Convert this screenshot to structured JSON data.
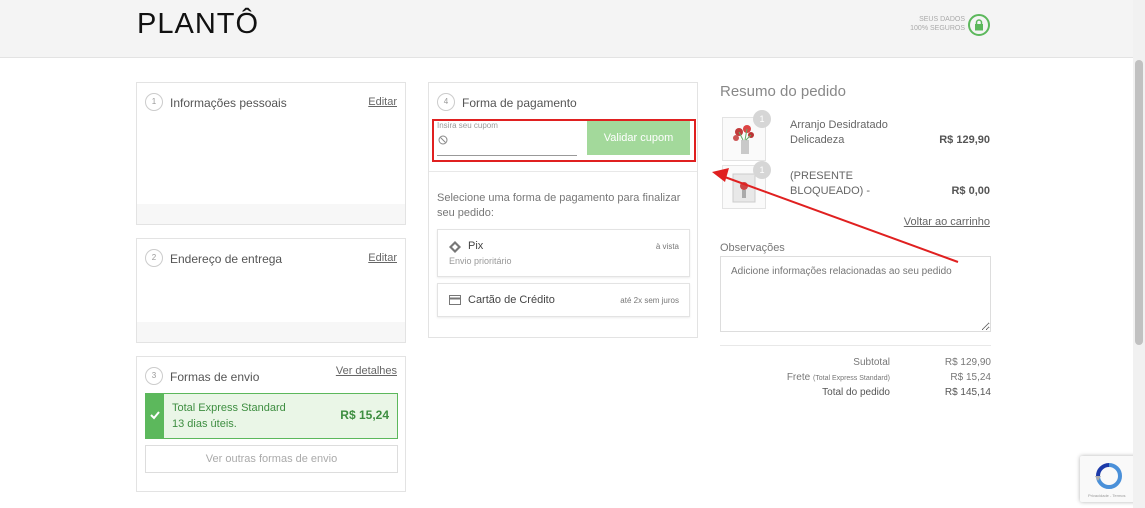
{
  "header": {
    "logo": "PLANTÔ",
    "secure_line1": "SEUS DADOS",
    "secure_line2": "100% SEGUROS",
    "lock_icon": "lock-icon"
  },
  "personal": {
    "step": "1",
    "title": "Informações pessoais",
    "edit_label": "Editar"
  },
  "delivery": {
    "step": "2",
    "title": "Endereço de entrega",
    "edit_label": "Editar"
  },
  "shipping": {
    "step": "3",
    "title": "Formas de envio",
    "details_label": "Ver detalhes",
    "selected_name": "Total Express Standard",
    "selected_days": "13 dias úteis.",
    "selected_price": "R$ 15,24",
    "other_options_label": "Ver outras formas de envio"
  },
  "payment": {
    "step": "4",
    "title": "Forma de pagamento",
    "coupon_label": "Insira seu cupom",
    "coupon_value": "",
    "coupon_button": "Validar cupom",
    "instructions": "Selecione uma forma de pagamento para finalizar seu pedido:",
    "options": [
      {
        "name": "Pix",
        "sub": "Envio prioritário",
        "right": "à vista",
        "icon": "pix-icon"
      },
      {
        "name": "Cartão de Crédito",
        "sub": "",
        "right": "até 2x sem juros",
        "icon": "credit-card-icon"
      }
    ]
  },
  "summary": {
    "title": "Resumo do pedido",
    "products": [
      {
        "qty": "1",
        "name": "Arranjo Desidratado Delicadeza",
        "price": "R$ 129,90"
      },
      {
        "qty": "1",
        "name": "(PRESENTE BLOQUEADO) -",
        "price": "R$ 0,00"
      }
    ],
    "cart_link": "Voltar ao carrinho",
    "obs_label": "Observações",
    "obs_placeholder": "Adicione informações relacionadas ao seu pedido",
    "subtotal_label": "Subtotal",
    "subtotal_value": "R$ 129,90",
    "shipping_label": "Frete",
    "shipping_sub": "(Total Express Standard)",
    "shipping_value": "R$ 15,24",
    "total_label": "Total do pedido",
    "total_value": "R$ 145,14"
  },
  "recaptcha": {
    "footer": "Privacidade - Termos"
  },
  "colors": {
    "accent_green": "#5cb85c",
    "annotation_red": "#e02020"
  }
}
